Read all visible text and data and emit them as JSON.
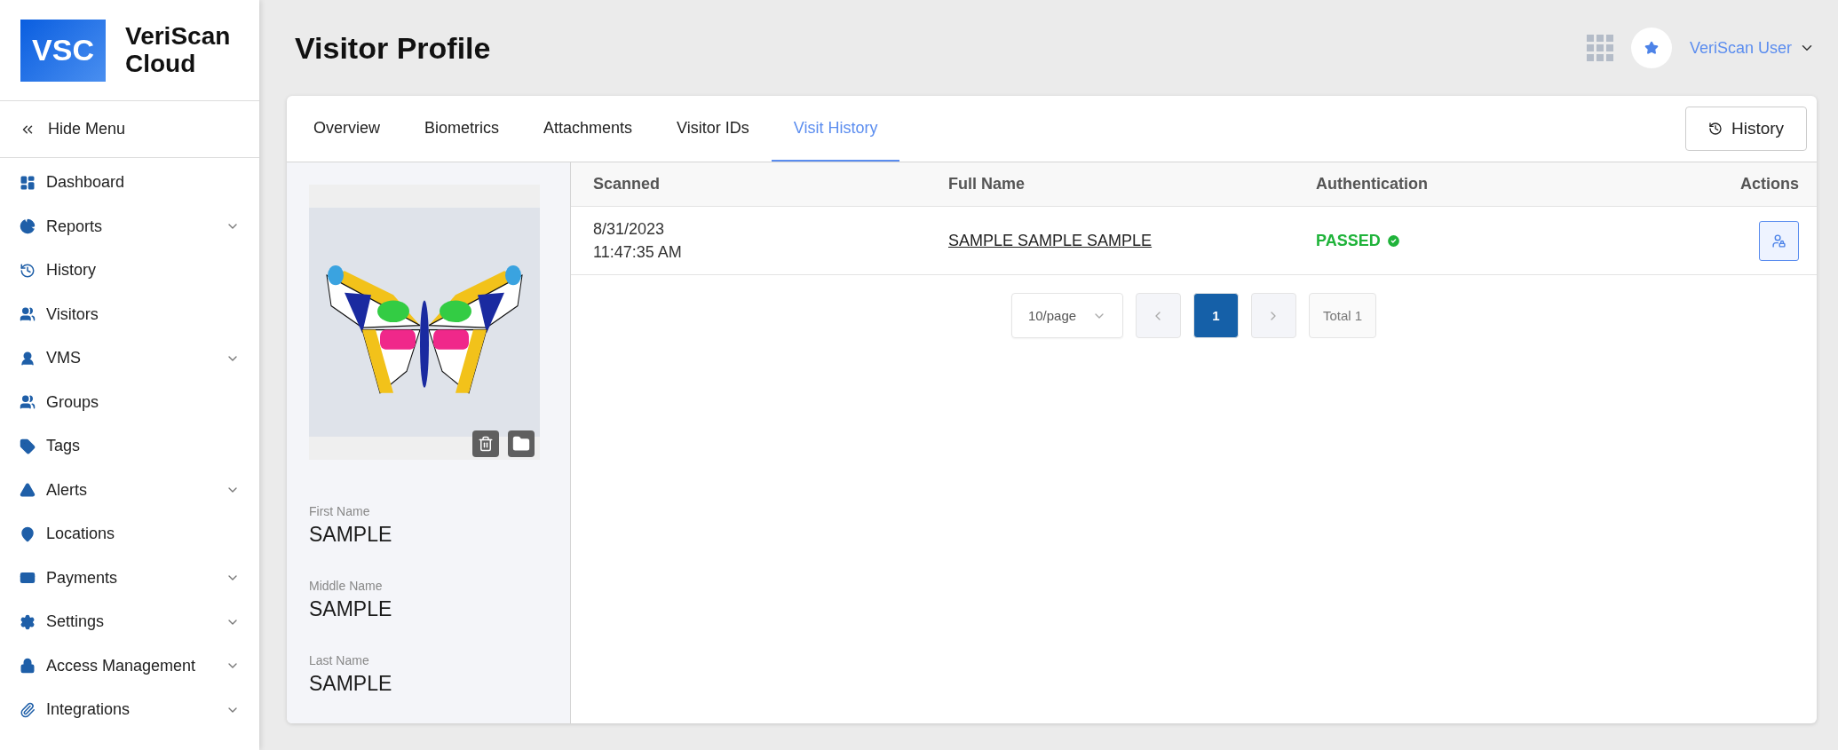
{
  "brand": {
    "logo": "VSC",
    "name": "VeriScan Cloud"
  },
  "sidebar": {
    "hide_menu": "Hide Menu",
    "items": [
      {
        "label": "Dashboard",
        "expandable": false
      },
      {
        "label": "Reports",
        "expandable": true
      },
      {
        "label": "History",
        "expandable": false
      },
      {
        "label": "Visitors",
        "expandable": false
      },
      {
        "label": "VMS",
        "expandable": true
      },
      {
        "label": "Groups",
        "expandable": false
      },
      {
        "label": "Tags",
        "expandable": false
      },
      {
        "label": "Alerts",
        "expandable": true
      },
      {
        "label": "Locations",
        "expandable": false
      },
      {
        "label": "Payments",
        "expandable": true
      },
      {
        "label": "Settings",
        "expandable": true
      },
      {
        "label": "Access Management",
        "expandable": true
      },
      {
        "label": "Integrations",
        "expandable": true
      }
    ]
  },
  "header": {
    "title": "Visitor Profile",
    "user": "VeriScan User"
  },
  "tabs": [
    {
      "label": "Overview",
      "selected": false
    },
    {
      "label": "Biometrics",
      "selected": false
    },
    {
      "label": "Attachments",
      "selected": false
    },
    {
      "label": "Visitor IDs",
      "selected": false
    },
    {
      "label": "Visit History",
      "selected": true
    }
  ],
  "history_button": "History",
  "profile": {
    "fields": [
      {
        "label": "First Name",
        "value": "SAMPLE"
      },
      {
        "label": "Middle Name",
        "value": "SAMPLE"
      },
      {
        "label": "Last Name",
        "value": "SAMPLE"
      }
    ]
  },
  "table": {
    "columns": [
      "Scanned",
      "Full Name",
      "Authentication",
      "Actions"
    ],
    "rows": [
      {
        "scanned_date": "8/31/2023",
        "scanned_time": "11:47:35 AM",
        "full_name": "SAMPLE SAMPLE SAMPLE",
        "authentication": {
          "text": "PASSED",
          "passed": true
        }
      }
    ]
  },
  "pagination": {
    "page_size": "10/page",
    "pages": [
      {
        "label": "1",
        "selected": true
      }
    ],
    "total": "Total 1"
  }
}
